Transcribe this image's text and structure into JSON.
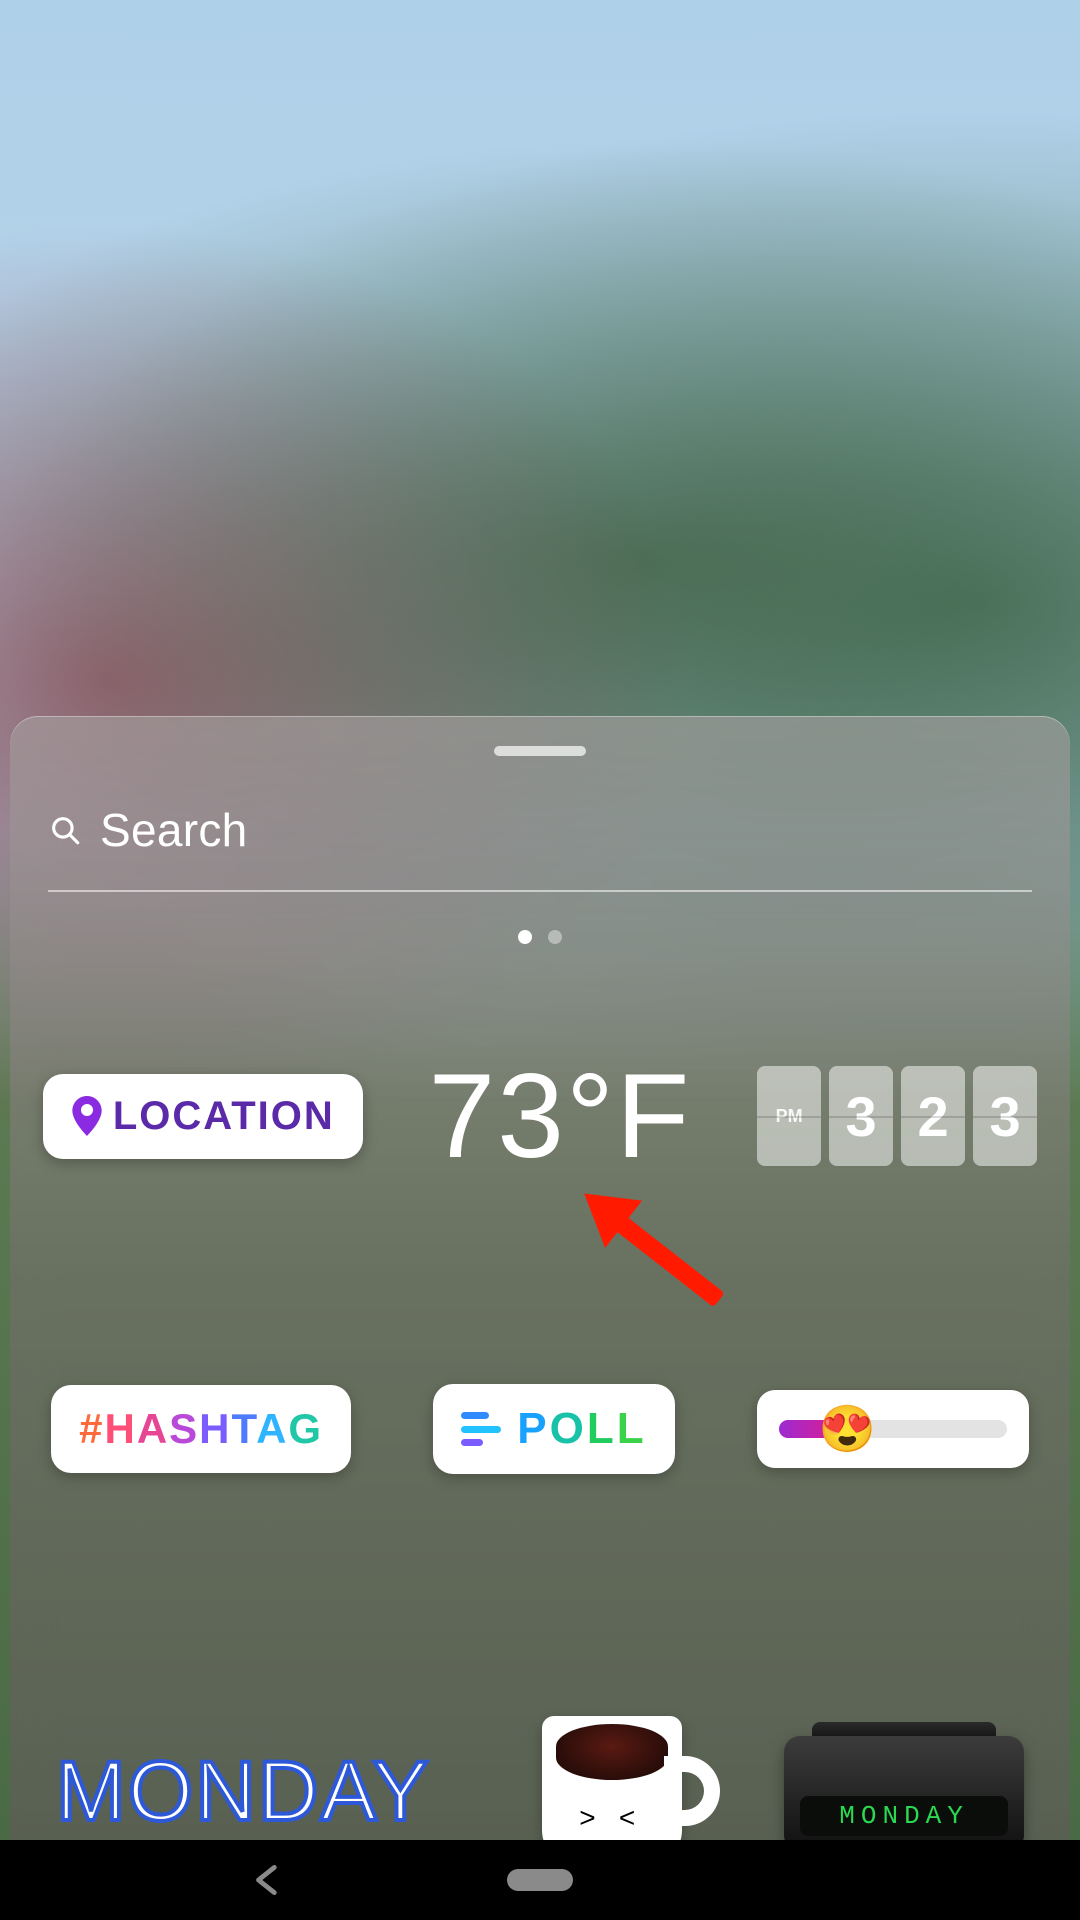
{
  "search": {
    "placeholder": "Search"
  },
  "pager": {
    "active_index": 0,
    "count": 2
  },
  "stickers": {
    "location": {
      "label": "LOCATION"
    },
    "temperature": {
      "display": "73°F",
      "value": 73,
      "unit": "F"
    },
    "clock": {
      "period": "PM",
      "h": "3",
      "m1": "2",
      "m2": "3"
    },
    "hashtag": {
      "label": "#HASHTAG"
    },
    "poll": {
      "label": "POLL"
    },
    "emoji_slider": {
      "emoji": "😍",
      "value_percent": 28
    },
    "day_label": {
      "text": "MONDAY"
    },
    "boombox": {
      "led_text": "MONDAY"
    }
  },
  "annotation": {
    "points_to": "poll-sticker"
  }
}
